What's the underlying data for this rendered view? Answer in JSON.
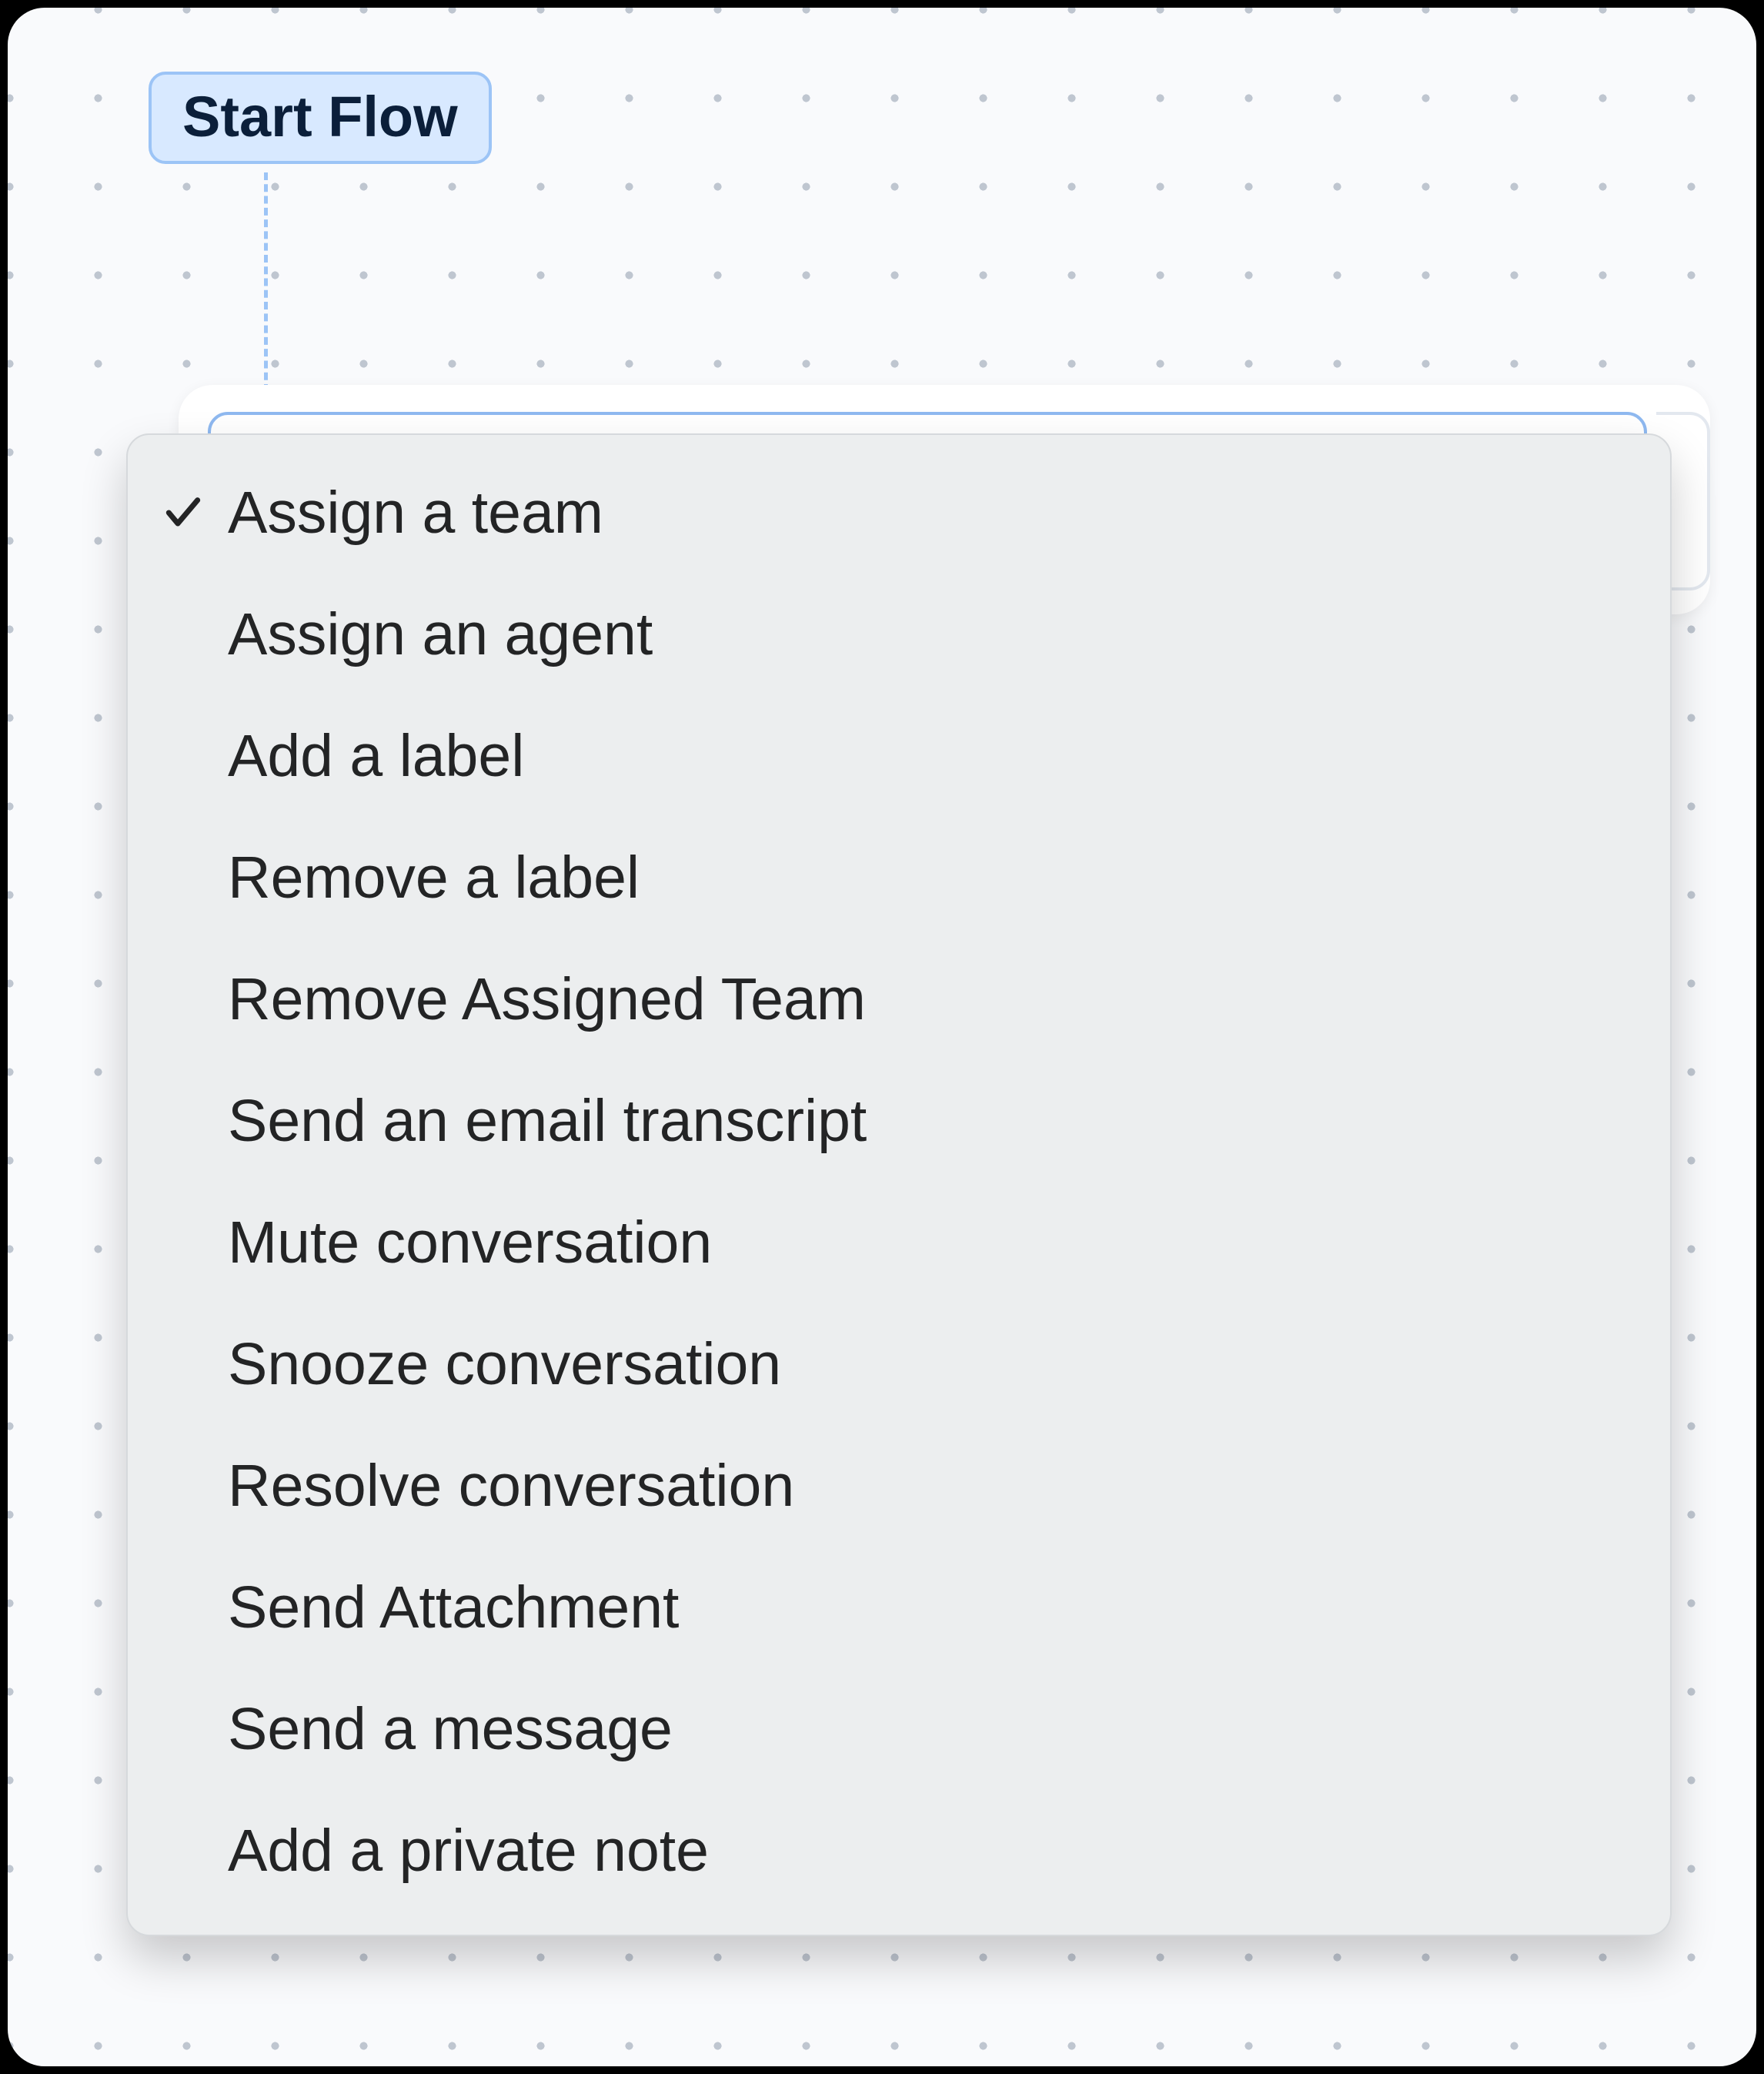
{
  "flow": {
    "start_label": "Start Flow"
  },
  "dropdown": {
    "selected_index": 0,
    "items": [
      {
        "label": "Assign a team"
      },
      {
        "label": "Assign an agent"
      },
      {
        "label": "Add a label"
      },
      {
        "label": "Remove a label"
      },
      {
        "label": "Remove Assigned Team"
      },
      {
        "label": "Send an email transcript"
      },
      {
        "label": "Mute conversation"
      },
      {
        "label": "Snooze conversation"
      },
      {
        "label": "Resolve conversation"
      },
      {
        "label": "Send Attachment"
      },
      {
        "label": "Send a message"
      },
      {
        "label": "Add a private note"
      }
    ]
  }
}
